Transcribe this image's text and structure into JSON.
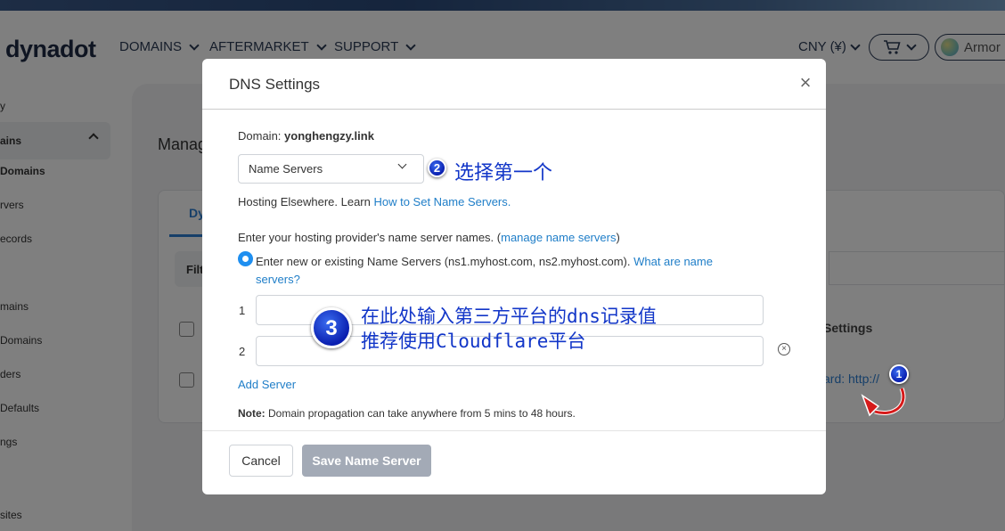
{
  "header": {
    "logo": "dynadot",
    "nav": [
      {
        "label": "DOMAINS"
      },
      {
        "label": "AFTERMARKET"
      },
      {
        "label": "SUPPORT"
      }
    ],
    "currency": "CNY (¥)",
    "account": "Armor"
  },
  "sidebar": {
    "items": [
      "y",
      "ains",
      "Domains",
      "rvers",
      "ecords",
      "mains",
      "Domains",
      "ders",
      "Defaults",
      "ngs",
      "sites"
    ]
  },
  "main": {
    "title": "Manag",
    "tab_partial": "Dy",
    "filter_partial": "Filt",
    "col_settings": "Settings",
    "forward_link": "ard: http://"
  },
  "modal": {
    "title": "DNS Settings",
    "close": "×",
    "domain_label": "Domain:",
    "domain_value": "yonghengzy.link",
    "select_value": "Name Servers",
    "hosting_text": "Hosting Elsewhere. Learn ",
    "hosting_link": "How to Set Name Servers.",
    "enter_text": "Enter your hosting provider's name server names. (",
    "manage_link": "manage name servers",
    "enter_close": ")",
    "radio_text": "Enter new or existing Name Servers (ns1.myhost.com, ns2.myhost.com). ",
    "radio_link_1": "What are name",
    "radio_link_2": "servers?",
    "ns_rows": [
      {
        "label": "1",
        "value": ""
      },
      {
        "label": "2",
        "value": ""
      }
    ],
    "add_server": "Add Server",
    "note_label": "Note:",
    "note_text": " Domain propagation can take anywhere from 5 mins to 48 hours.",
    "cancel": "Cancel",
    "save": "Save Name Server"
  },
  "annotations": {
    "step1": "1",
    "step2": "2",
    "step2_text": "选择第一个",
    "step3": "3",
    "step3_line1": "在此处输入第三方平台的dns记录值",
    "step3_line2": "推荐使用Cloudflare平台"
  }
}
